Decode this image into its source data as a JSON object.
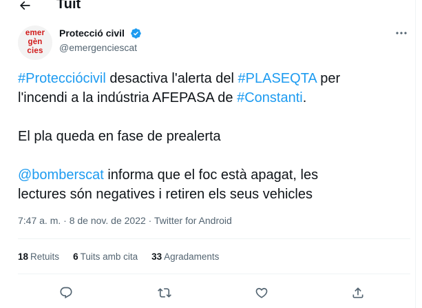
{
  "header": {
    "title": "Tuit",
    "back_icon": "arrow-left-icon"
  },
  "author": {
    "avatar_lines": [
      "emer",
      "gèn",
      "cies"
    ],
    "name": "Protecció civil",
    "handle": "@emergenciescat",
    "verified_icon": "verified-badge-icon",
    "more_icon": "more-horizontal-icon"
  },
  "tweet": {
    "line1": {
      "h1": "#Protecciócivil",
      "t1": " desactiva l'alerta del ",
      "h2": "#PLASEQTA",
      "t2": " per"
    },
    "line2": {
      "t1": "l'incendi a la indústria AFEPASA de ",
      "h1": "#Constanti",
      "t2": "."
    },
    "line3": "El pla queda en fase de prealerta",
    "line4": {
      "m1": "@bomberscat",
      "t1": " informa que el foc està apagat, les"
    },
    "line5": "lectures són negatives i retiren els seus vehicles"
  },
  "meta": {
    "time": "7:47 a. m.",
    "sep1": " · ",
    "date": "8 de nov. de 2022",
    "sep2": " · ",
    "source": "Twitter for Android"
  },
  "stats": {
    "retweets_count": "18",
    "retweets_label": "Retuits",
    "quotes_count": "6",
    "quotes_label": "Tuits amb cita",
    "likes_count": "33",
    "likes_label": "Agradaments"
  },
  "actions": [
    "reply-icon",
    "retweet-icon",
    "like-icon",
    "share-icon"
  ],
  "colors": {
    "link": "#1d9bf0",
    "text": "#0f1419",
    "secondary": "#536471",
    "border": "#eff3f4",
    "brand": "#d11a1a"
  }
}
